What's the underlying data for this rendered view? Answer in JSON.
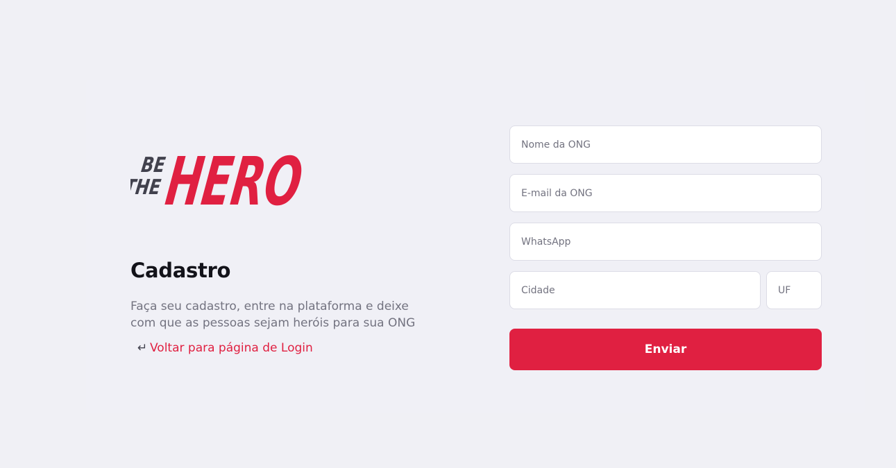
{
  "logo": {
    "line1": "BE",
    "line2": "THE",
    "word": "HERO",
    "accent": "#e02041",
    "dark": "#41414d"
  },
  "register": {
    "title": "Cadastro",
    "description": "Faça seu cadastro, entre na plataforma e deixe com que as pessoas sejam heróis para sua ONG",
    "back_icon": "↵",
    "back_label": "Voltar para página de Login"
  },
  "form": {
    "name_placeholder": "Nome da ONG",
    "email_placeholder": "E-mail da ONG",
    "whatsapp_placeholder": "WhatsApp",
    "city_placeholder": "Cidade",
    "uf_placeholder": "UF",
    "submit_label": "Enviar"
  }
}
